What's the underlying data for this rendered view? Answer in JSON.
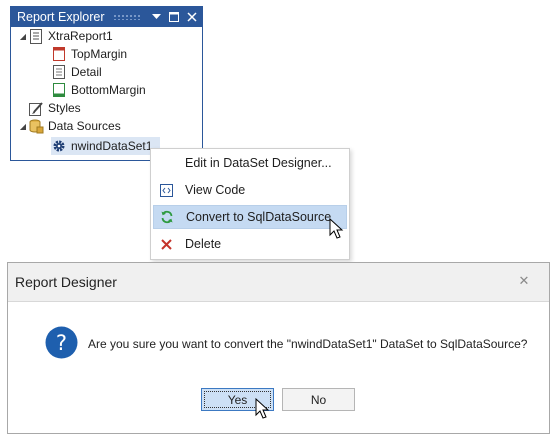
{
  "explorer": {
    "title": "Report Explorer",
    "tree": {
      "report": "XtraReport1",
      "bands": [
        "TopMargin",
        "Detail",
        "BottomMargin"
      ],
      "styles": "Styles",
      "data_sources": "Data Sources",
      "dataset": "nwindDataSet1"
    }
  },
  "context_menu": {
    "items": [
      {
        "label": "Edit in DataSet Designer...",
        "icon": ""
      },
      {
        "label": "View Code",
        "icon": "code-icon"
      },
      {
        "label": "Convert to SqlDataSource",
        "icon": "refresh-icon"
      },
      {
        "label": "Delete",
        "icon": "delete-icon"
      }
    ],
    "highlighted": "Convert to SqlDataSource"
  },
  "dialog": {
    "title": "Report Designer",
    "message": "Are you sure you want to convert the \"nwindDataSet1\" DataSet to SqlDataSource?",
    "yes_label": "Yes",
    "no_label": "No",
    "icon": "question-icon"
  },
  "colors": {
    "title_bar": "#2b579a",
    "menu_highlight": "#c5daf2",
    "question_icon": "#1e5fae"
  }
}
